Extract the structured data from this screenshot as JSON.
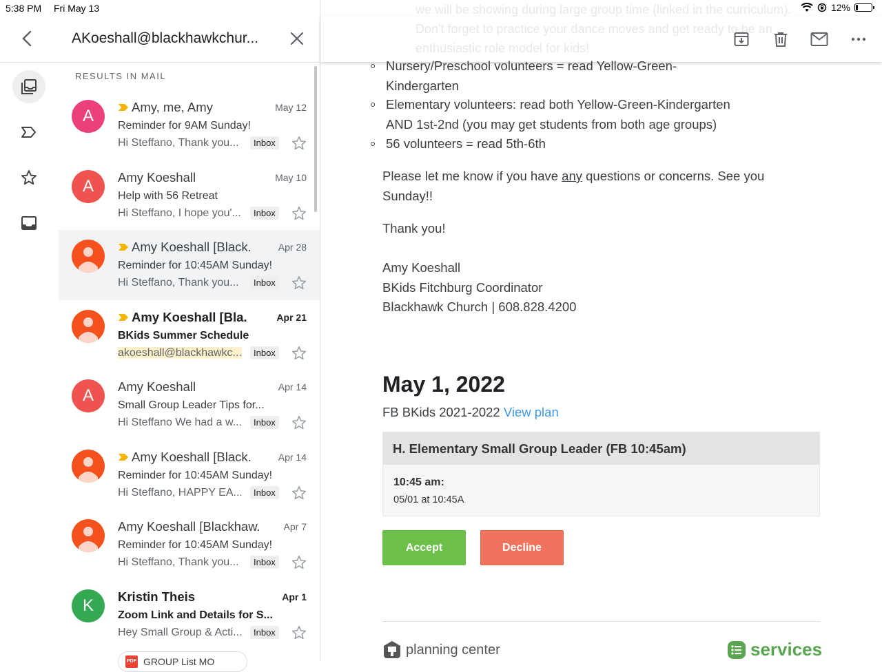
{
  "status": {
    "time": "5:38 PM",
    "date": "Fri May 13",
    "battery": "12%",
    "battery_level": 0.12
  },
  "search": {
    "query": "AKoeshall@blackhawkchur..."
  },
  "results_label": "RESULTS IN MAIL",
  "emails": [
    {
      "initial": "A",
      "avatar_color": "#ec407a",
      "avatar_type": "letter",
      "sender": "Amy, me, Amy",
      "important": true,
      "bold": false,
      "date": "May 12",
      "subject": "Reminder for 9AM Sunday!",
      "snippet": "Hi Steffano, Thank you...",
      "label": "Inbox"
    },
    {
      "initial": "A",
      "avatar_color": "#ef5350",
      "avatar_type": "letter",
      "sender": "Amy Koeshall",
      "important": false,
      "bold": false,
      "date": "May 10",
      "subject": "Help with 56 Retreat",
      "snippet": "Hi Steffano, I hope you'...",
      "label": "Inbox"
    },
    {
      "initial": "",
      "avatar_color": "#f4511e",
      "avatar_type": "person",
      "sender": "Amy Koeshall [Black.",
      "important": true,
      "bold": false,
      "date": "Apr 28",
      "subject": "Reminder for 10:45AM Sunday!",
      "snippet": "Hi Steffano, Thank you...",
      "label": "Inbox"
    },
    {
      "initial": "",
      "avatar_color": "#f4511e",
      "avatar_type": "person",
      "sender": "Amy Koeshall [Bla.",
      "important": true,
      "bold": true,
      "date": "Apr 21",
      "subject": "BKids Summer Schedule",
      "snippet": "akoeshall@blackhawkc...",
      "label": "Inbox"
    },
    {
      "initial": "A",
      "avatar_color": "#ef5350",
      "avatar_type": "letter",
      "sender": "Amy Koeshall",
      "important": false,
      "bold": false,
      "date": "Apr 14",
      "subject": "Small Group Leader Tips for...",
      "snippet": "Hi Steffano We had a w...",
      "label": "Inbox"
    },
    {
      "initial": "",
      "avatar_color": "#f4511e",
      "avatar_type": "person",
      "sender": "Amy Koeshall [Black.",
      "important": true,
      "bold": false,
      "date": "Apr 14",
      "subject": "Reminder for 10:45AM Sunday!",
      "snippet": "Hi Steffano, HAPPY EA...",
      "label": "Inbox"
    },
    {
      "initial": "",
      "avatar_color": "#f4511e",
      "avatar_type": "person",
      "sender": "Amy Koeshall [Blackhaw.",
      "important": false,
      "bold": false,
      "date": "Apr 7",
      "subject": "Reminder for 10:45AM Sunday!",
      "snippet": "Hi Steffano, Thank you...",
      "label": "Inbox"
    },
    {
      "initial": "K",
      "avatar_color": "#34a853",
      "avatar_type": "letter",
      "sender": "Kristin Theis",
      "important": false,
      "bold": true,
      "date": "Apr 1",
      "subject": "Zoom Link and Details for S...",
      "snippet": "Hey Small Group & Acti...",
      "label": "Inbox",
      "attachment": "GROUP List MO"
    }
  ],
  "message": {
    "faded_lines": [
      "we will be showing during large group time (linked in the curriculum).",
      "Don't forget to practice your dance moves and get ready to be an",
      "enthusiastic role model for kids!"
    ],
    "bullets": [
      [
        "Nursery/Preschool volunteers = read Yellow-Green-",
        "Kindergarten"
      ],
      [
        "Elementary volunteers: read both Yellow-Green-Kindergarten",
        "AND 1st-2nd (you may get students from both age groups)"
      ],
      [
        "56 volunteers = read 5th-6th"
      ]
    ],
    "para1_a": "Please let me know if you have ",
    "para1_u": "any",
    "para1_b": " questions or concerns. See you",
    "para1_c": "Sunday!!",
    "thanks": "Thank you!",
    "sig_name": "Amy Koeshall",
    "sig_title": "BKids Fitchburg Coordinator",
    "sig_org": "Blackhawk Church | 608.828.4200"
  },
  "plan": {
    "date": "May 1, 2022",
    "service_name": "FB BKids 2021-2022",
    "view_plan": "View plan",
    "role": "H. Elementary Small Group Leader (FB 10:45am)",
    "time_label": "10:45 am:",
    "time_detail": "05/01 at 10:45A",
    "accept": "Accept",
    "decline": "Decline"
  },
  "footer": {
    "pc_brand": "planning center",
    "services_brand": "services"
  },
  "colors": {
    "accept": "#6cc04a",
    "decline": "#f0735e",
    "link": "#3f99e8",
    "importance": "#f4b400",
    "services": "#5aa550"
  }
}
